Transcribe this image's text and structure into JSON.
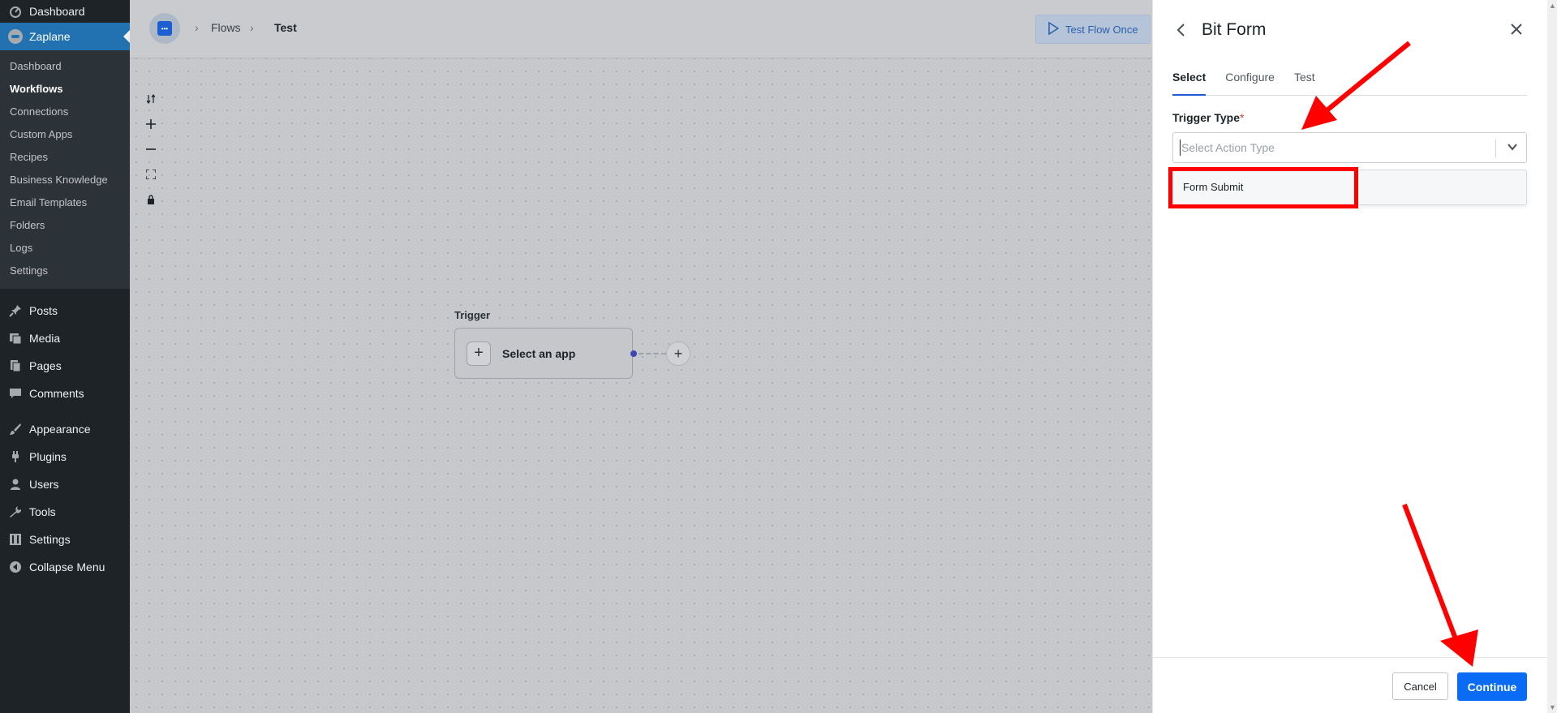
{
  "wp_sidebar": {
    "top_item": "Dashboard",
    "active_plugin": "Zaplane",
    "submenu": [
      "Dashboard",
      "Workflows",
      "Connections",
      "Custom Apps",
      "Recipes",
      "Business Knowledge",
      "Email Templates",
      "Folders",
      "Logs",
      "Settings"
    ],
    "current_submenu": "Workflows",
    "menu": [
      {
        "label": "Posts",
        "icon": "pin-icon"
      },
      {
        "label": "Media",
        "icon": "media-icon"
      },
      {
        "label": "Pages",
        "icon": "pages-icon"
      },
      {
        "label": "Comments",
        "icon": "comments-icon"
      },
      {
        "label": "Appearance",
        "icon": "brush-icon"
      },
      {
        "label": "Plugins",
        "icon": "plug-icon"
      },
      {
        "label": "Users",
        "icon": "user-icon"
      },
      {
        "label": "Tools",
        "icon": "wrench-icon"
      },
      {
        "label": "Settings",
        "icon": "settings-icon"
      },
      {
        "label": "Collapse Menu",
        "icon": "collapse-icon"
      }
    ]
  },
  "topbar": {
    "breadcrumb": [
      "Flows",
      "Test"
    ],
    "test_flow_button": "Test Flow Once"
  },
  "canvas": {
    "trigger_label": "Trigger",
    "node_text": "Select an app"
  },
  "drawer": {
    "title": "Bit Form",
    "tabs": [
      "Select",
      "Configure",
      "Test"
    ],
    "active_tab": "Select",
    "field_label": "Trigger Type",
    "required_mark": "*",
    "select_placeholder": "Select Action Type",
    "options": [
      "Form Submit"
    ],
    "cancel_label": "Cancel",
    "continue_label": "Continue"
  },
  "colors": {
    "wp_sidebar_bg": "#1d2327",
    "wp_accent": "#2271b1",
    "primary_button": "#0a6cf5",
    "annotation_red": "#ff0000"
  }
}
